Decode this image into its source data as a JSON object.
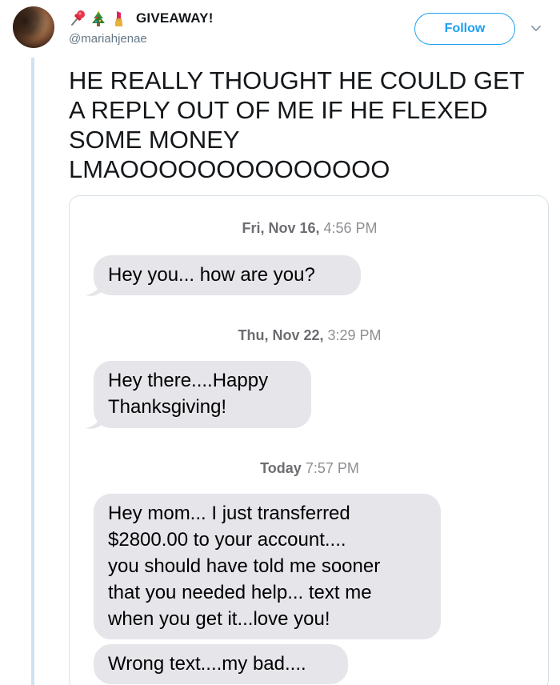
{
  "tweet": {
    "emojis": [
      "pushpin-emoji",
      "christmas-tree-emoji",
      "lipstick-emoji"
    ],
    "display_name": "GIVEAWAY!",
    "handle": "@mariahjenae",
    "follow_label": "Follow",
    "text": "HE REALLY THOUGHT HE COULD GET\nA REPLY OUT OF ME IF HE FLEXED\nSOME MONEY\nLMAOOOOOOOOOOOOOO"
  },
  "conversation": {
    "timestamps": [
      {
        "day": "Fri, Nov 16,",
        "time": " 4:56 PM"
      },
      {
        "day": "Thu, Nov 22,",
        "time": " 3:29 PM"
      },
      {
        "day": "Today",
        "time": " 7:57 PM"
      }
    ],
    "messages": [
      {
        "text": "Hey you... how are you?"
      },
      {
        "text": "Hey there....Happy\nThanksgiving!"
      },
      {
        "text": "Hey mom... I just transferred\n$2800.00 to your account....\nyou should have told me sooner\nthat you needed help... text me\nwhen you get it...love you!"
      },
      {
        "text": "Wrong text....my bad...."
      }
    ]
  },
  "colors": {
    "accent": "#1da1f2",
    "bubble_gray": "#e5e5ea",
    "thread_line": "#cfe3f2"
  }
}
